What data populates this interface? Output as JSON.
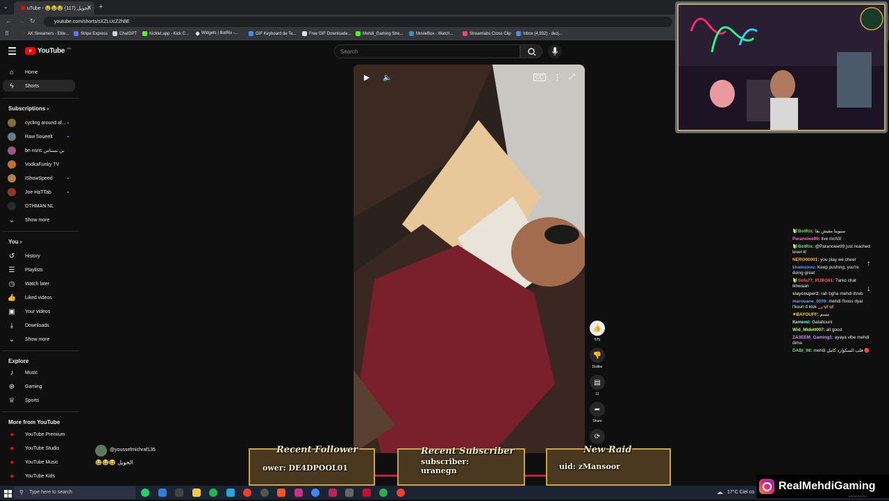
{
  "browser": {
    "tab_title": "uTube - 😂😂😂 الخويل (117)",
    "url": "youtube.com/shorts/sXZLUcZ2h8E",
    "bookmarks": [
      "AK Streamers - Elite...",
      "Stripe Express",
      "ChatGPT",
      "Kicklet.app - Kick C...",
      "Widgets | BotRix -...",
      "GIF Keyboard de Te...",
      "Free GIF Downloade...",
      "Mehdi_Gaming Stre...",
      "MovieBox - Watch...",
      "Streamlabs Cross Clip",
      "Inbox (4,932) - dezj..."
    ]
  },
  "youtube": {
    "logo_text": "YouTube",
    "logo_country": "MA",
    "search_placeholder": "Search",
    "sidebar": {
      "home": "Home",
      "shorts": "Shorts",
      "subscriptions_title": "Subscriptions",
      "subscriptions": [
        {
          "name": "cycling around af...",
          "color": "#8a6a3a",
          "dot": true
        },
        {
          "name": "Raw Soueelt",
          "color": "#6a7a8a",
          "dot": true
        },
        {
          "name": "bn nsns بن نسناس",
          "color": "#9a5a7a",
          "dot": false
        },
        {
          "name": "VodkaFunky TV",
          "color": "#c07030",
          "dot": false
        },
        {
          "name": "IShowSpeed",
          "color": "#b08050",
          "dot": true
        },
        {
          "name": "Joe HaTTab",
          "color": "#8a3a2a",
          "dot": true
        },
        {
          "name": "OTHMAN NL",
          "color": "#2a2a2a",
          "dot": false
        }
      ],
      "show_more": "Show more",
      "you_title": "You",
      "you_items": [
        "History",
        "Playlists",
        "Watch later",
        "Liked videos",
        "Your videos",
        "Downloads"
      ],
      "show_more_2": "Show more",
      "explore_title": "Explore",
      "explore_items": [
        "Music",
        "Gaming",
        "Sports"
      ],
      "more_title": "More from YouTube",
      "more_items": [
        "YouTube Premium",
        "YouTube Studio",
        "YouTube Music",
        "YouTube Kids"
      ]
    },
    "short": {
      "likes": "575",
      "dislike_label": "Dislike",
      "comments": "11",
      "share_label": "Share"
    },
    "comment_overlay": {
      "user": "@youssefmichraf135",
      "text": "😂😂😂 الخويل"
    }
  },
  "stream": {
    "chat": [
      {
        "user": "🔰BotRix:",
        "text": "سيوبنا مفيش بقا",
        "color": "#7fd27f"
      },
      {
        "user": "Paranoiee99:",
        "text": "live mch3l",
        "color": "#ff6ad5"
      },
      {
        "user": "🔰BotRix:",
        "text": "@Paranoiee99 just reached level 4!",
        "color": "#7fd27f"
      },
      {
        "user": "NERO00001:",
        "text": "you play we cheer",
        "color": "#ffb347"
      },
      {
        "user": "khamsouu:",
        "text": "Keep pushing, you're doing great",
        "color": "#5aa0ff"
      },
      {
        "user": "🔰Sofa77_PUBG01:",
        "text": "7arko chat ikhwaan",
        "color": "#ff5a5a"
      },
      {
        "user": "slaycouper2:",
        "text": "rah bgha mehdi ihreb",
        "color": "#d0d0d0"
      },
      {
        "user": "marouane_0009:",
        "text": "mehdi l'boss dyal l'koun d kick 🏎️🦋🦋",
        "color": "#5aa0ff"
      },
      {
        "user": "✦BAYOUFF:",
        "text": "مسم",
        "color": "#ffd700"
      },
      {
        "user": "Itameml:",
        "text": "Gataltouni",
        "color": "#7fffd4"
      },
      {
        "user": "Wid_Midett007:",
        "text": "all good",
        "color": "#c0ff7f"
      },
      {
        "user": "ZA3EEM_Gaming1:",
        "text": "ayaya vibe mehdi dima",
        "color": "#d98cff"
      },
      {
        "user": "DABI_98:",
        "text": "mehdi قلب السكوارد كامل 🔴",
        "color": "#7fd27f"
      }
    ],
    "panels": [
      {
        "title": "Recent Follower",
        "value": "ower: DE4DPOOL01"
      },
      {
        "title": "Recent Subscriber",
        "value": "subscriber: uranegn"
      },
      {
        "title": "New Raid",
        "value": "uid: zMansoor"
      }
    ],
    "brand": "RealMehdiGaming",
    "brand_small": "Real Mehdi Gaming"
  },
  "taskbar": {
    "search_placeholder": "Type here to search",
    "weather": "17°C Ciel co"
  }
}
